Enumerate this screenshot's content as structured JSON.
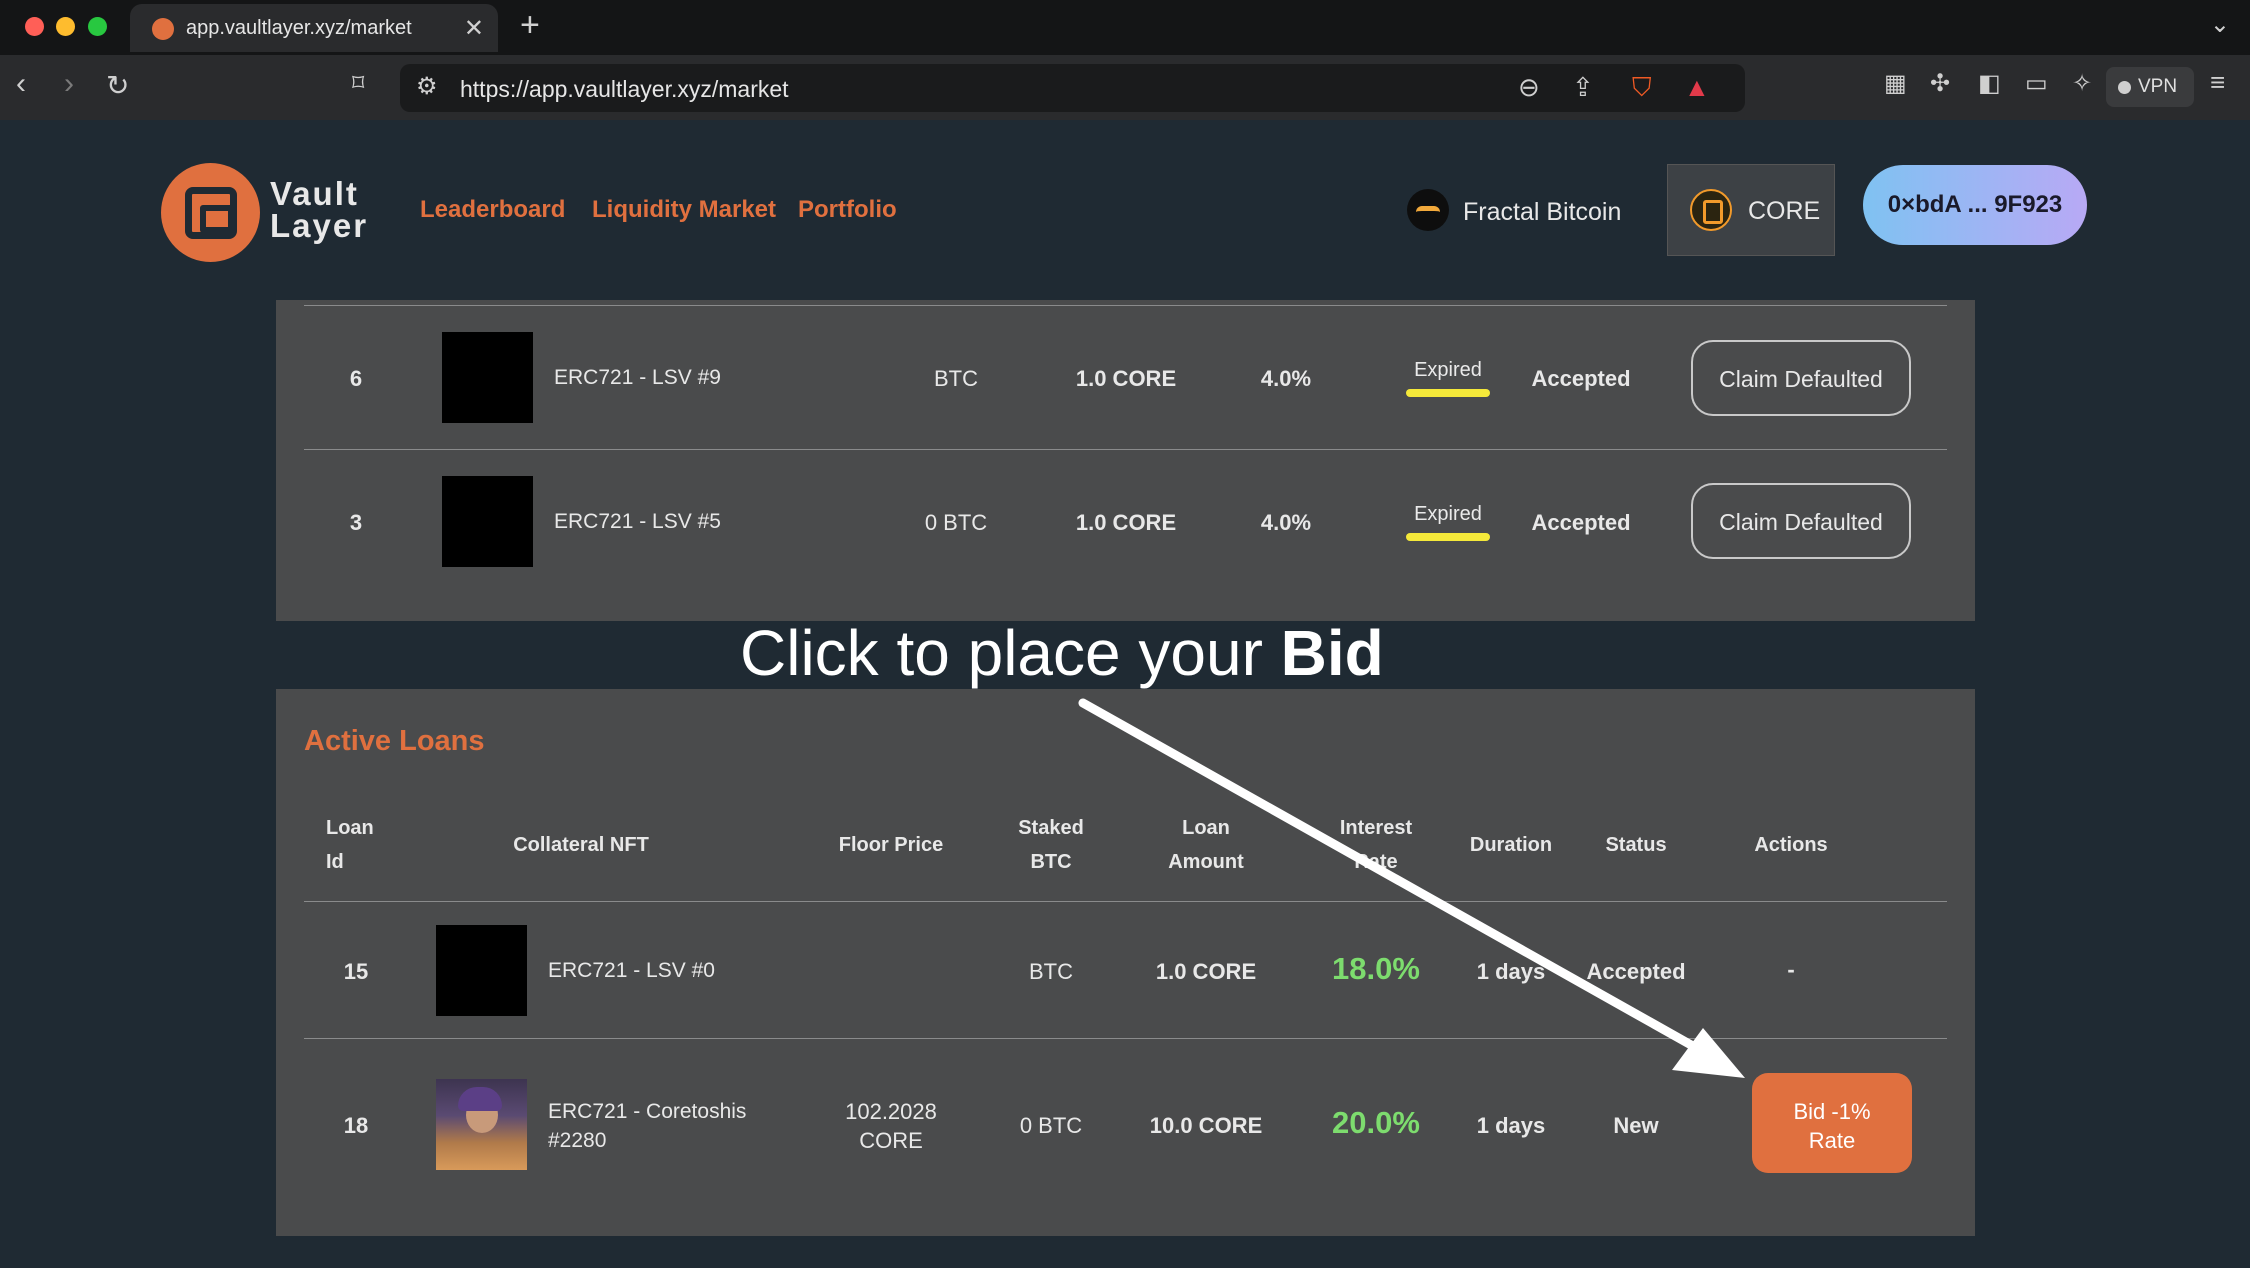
{
  "browser": {
    "tab_title": "app.vaultlayer.xyz/market",
    "url": "https://app.vaultlayer.xyz/market",
    "vpn_label": "VPN",
    "traffic_colors": [
      "#ff5f57",
      "#febc2e",
      "#28c840"
    ]
  },
  "header": {
    "logo_line1": "Vault",
    "logo_line2": "Layer",
    "nav": [
      "Leaderboard",
      "Liquidity Market",
      "Portfolio"
    ],
    "network_label": "Fractal Bitcoin",
    "chain_label": "CORE",
    "wallet_label": "0×bdA ... 9F923"
  },
  "expired_loans": {
    "rows": [
      {
        "id": "6",
        "nft": "ERC721 - LSV #9",
        "staked": "BTC",
        "amount": "1.0 CORE",
        "rate": "4.0%",
        "duration_status": "Expired",
        "status": "Accepted",
        "action": "Claim Defaulted"
      },
      {
        "id": "3",
        "nft": "ERC721 - LSV #5",
        "staked": "0 BTC",
        "amount": "1.0 CORE",
        "rate": "4.0%",
        "duration_status": "Expired",
        "status": "Accepted",
        "action": "Claim Defaulted"
      }
    ]
  },
  "annotation": {
    "prefix": "Click to place your ",
    "bold": "Bid"
  },
  "active_loans": {
    "title": "Active Loans",
    "headers": {
      "loan_id_1": "Loan",
      "loan_id_2": "Id",
      "collateral": "Collateral NFT",
      "floor": "Floor Price",
      "staked_1": "Staked",
      "staked_2": "BTC",
      "amount_1": "Loan",
      "amount_2": "Amount",
      "interest_1": "Interest",
      "interest_2": "Rate",
      "duration": "Duration",
      "status": "Status",
      "actions": "Actions"
    },
    "rows": [
      {
        "id": "15",
        "nft": "ERC721 - LSV #0",
        "floor_1": "",
        "floor_2": "",
        "staked": "BTC",
        "amount": "1.0 CORE",
        "rate": "18.0%",
        "duration": "1 days",
        "status": "Accepted",
        "action": "-"
      },
      {
        "id": "18",
        "nft_1": "ERC721 - Coretoshis",
        "nft_2": "#2280",
        "floor_1": "102.2028",
        "floor_2": "CORE",
        "staked": "0 BTC",
        "amount": "10.0 CORE",
        "rate": "20.0%",
        "duration": "1 days",
        "status": "New",
        "action_1": "Bid -1%",
        "action_2": "Rate"
      }
    ]
  },
  "colors": {
    "accent": "#e0703f",
    "rate_green": "#7ddc6e",
    "expired_highlight": "#f5e93a"
  }
}
